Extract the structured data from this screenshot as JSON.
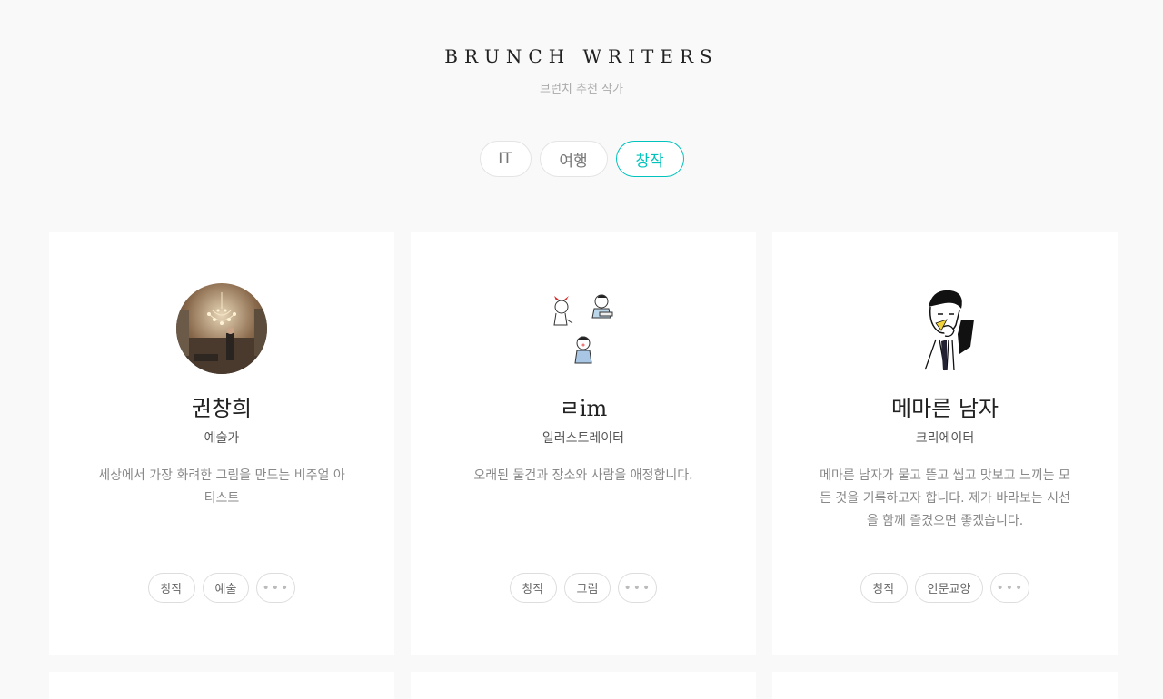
{
  "header": {
    "title": "BRUNCH WRITERS",
    "subtitle": "브런치 추천 작가"
  },
  "tabs": [
    {
      "label": "IT",
      "active": false
    },
    {
      "label": "여행",
      "active": false
    },
    {
      "label": "창작",
      "active": true
    }
  ],
  "colors": {
    "accent": "#00c3bd",
    "background": "#f9f9f9",
    "card": "#ffffff"
  },
  "writers": [
    {
      "name": "권창희",
      "role": "예술가",
      "description": "세상에서 가장 화려한 그림을 만드는 비주얼 아티스트",
      "tags": [
        "창작",
        "예술"
      ],
      "more_label": "•••",
      "avatar": "photo-avatar"
    },
    {
      "name": "ㄹim",
      "role": "일러스트레이터",
      "description": "오래된 물건과 장소와 사람을 애정합니다.",
      "tags": [
        "창작",
        "그림"
      ],
      "more_label": "•••",
      "avatar": "illustration-avatar"
    },
    {
      "name": "메마른 남자",
      "role": "크리에이터",
      "description": "메마른 남자가 물고 뜯고 씹고 맛보고 느끼는 모든 것을 기록하고자 합니다. 제가 바라보는 시선을 함께 즐겼으면 좋겠습니다.",
      "tags": [
        "창작",
        "인문교양"
      ],
      "more_label": "•••",
      "avatar": "sketch-avatar"
    }
  ]
}
